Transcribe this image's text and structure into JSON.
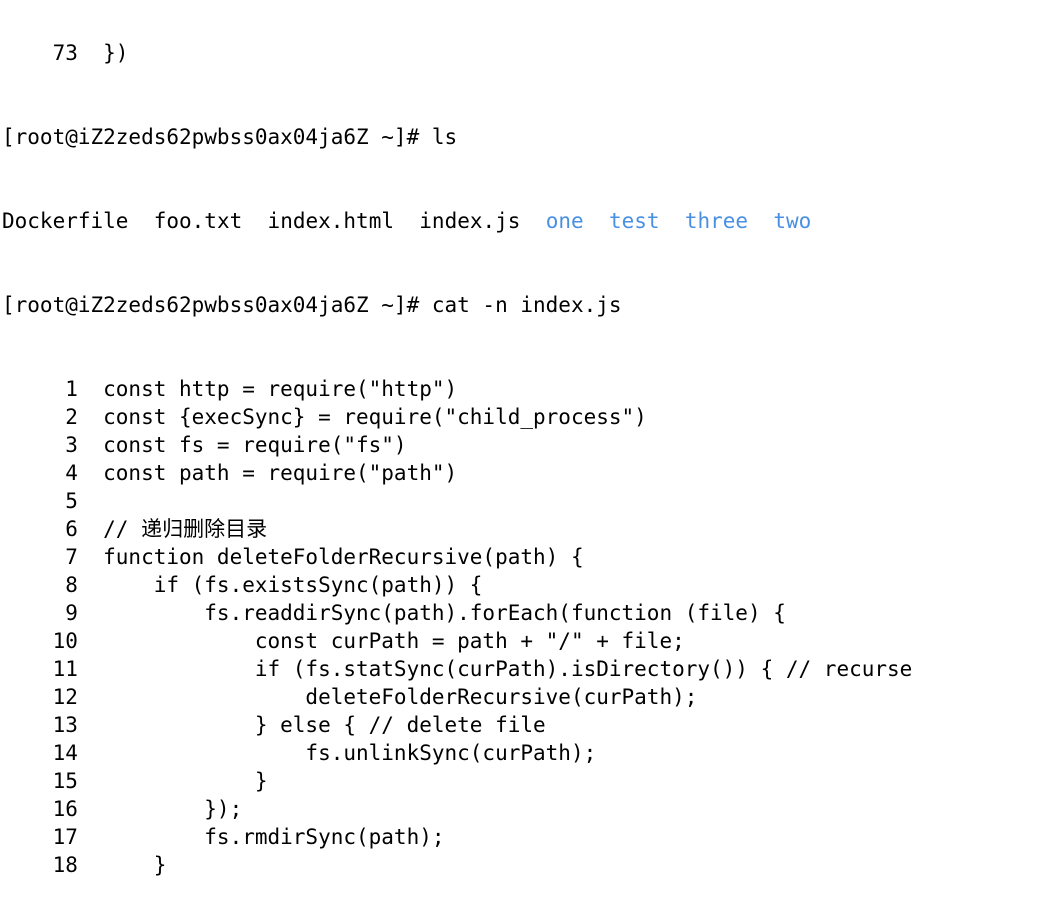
{
  "theme": {
    "background": "#ffffff",
    "text": "#000000",
    "directory": "#4a90e2"
  },
  "top_partial": "    73  })",
  "prompt1": "[root@iZ2zeds62pwbss0ax04ja6Z ~]# ls",
  "ls_files": [
    "Dockerfile",
    "foo.txt",
    "index.html",
    "index.js"
  ],
  "ls_dirs": [
    "one",
    "test",
    "three",
    "two"
  ],
  "prompt2": "[root@iZ2zeds62pwbss0ax04ja6Z ~]# cat -n index.js",
  "code": [
    "     1  const http = require(\"http\")",
    "     2  const {execSync} = require(\"child_process\")",
    "     3  const fs = require(\"fs\")",
    "     4  const path = require(\"path\")",
    "     5",
    "     6  // 递归删除目录",
    "     7  function deleteFolderRecursive(path) {",
    "     8      if (fs.existsSync(path)) {",
    "     9          fs.readdirSync(path).forEach(function (file) {",
    "    10              const curPath = path + \"/\" + file;",
    "    11              if (fs.statSync(curPath).isDirectory()) { // recurse",
    "    12                  deleteFolderRecursive(curPath);",
    "    13              } else { // delete file",
    "    14                  fs.unlinkSync(curPath);",
    "    15              }",
    "    16          });",
    "    17          fs.rmdirSync(path);",
    "    18      }"
  ]
}
